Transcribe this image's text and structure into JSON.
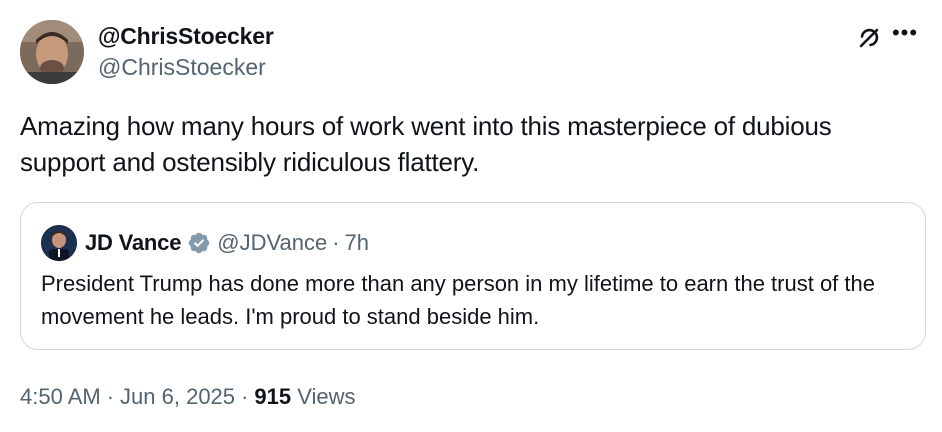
{
  "author": {
    "display_name": "@ChrisStoecker",
    "handle": "@ChrisStoecker"
  },
  "tweet": {
    "text": "Amazing how many hours of work went into this masterpiece of dubious support and ostensibly ridiculous flattery."
  },
  "quoted_tweet": {
    "display_name": "JD Vance",
    "handle": "@JDVance",
    "separator": "·",
    "time": "7h",
    "text": "President Trump has done more than any person in my lifetime to earn the trust of the movement he leads. I'm proud to stand beside him.",
    "verified_badge_color": "#829aab"
  },
  "meta": {
    "time": "4:50 AM",
    "date": "Jun 6, 2025",
    "separator": "·",
    "views_count": "915",
    "views_label": "Views"
  },
  "icons": {
    "grok": "grok-icon",
    "more": "more-icon",
    "verified": "verified-badge-icon"
  },
  "colors": {
    "text_primary": "#0f1419",
    "text_secondary": "#536471",
    "border": "#cfd9de"
  }
}
